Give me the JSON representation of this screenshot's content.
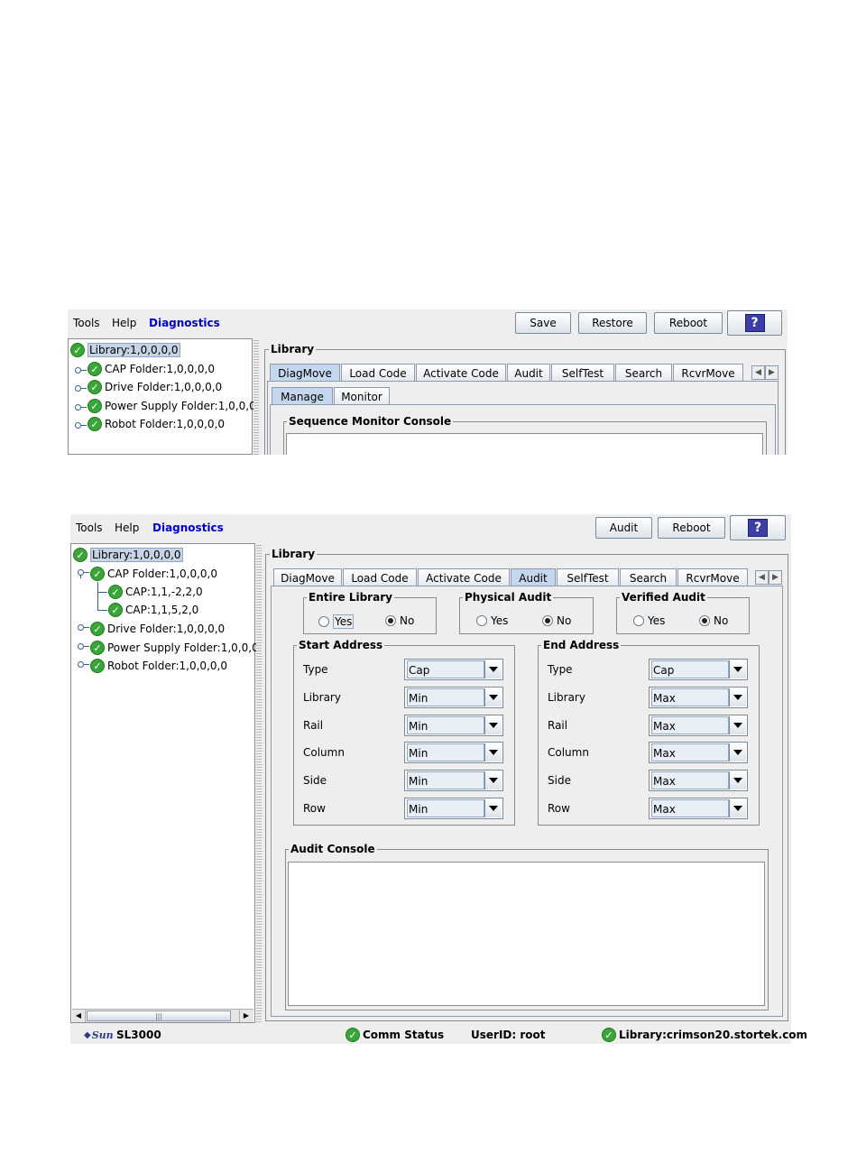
{
  "window1": {
    "menu": [
      "Tools",
      "Help",
      "Diagnostics"
    ],
    "toolbar": {
      "save": "Save",
      "restore": "Restore",
      "reboot": "Reboot",
      "help": "?"
    },
    "tree": {
      "root": "Library:1,0,0,0,0",
      "items": [
        "CAP Folder:1,0,0,0,0",
        "Drive Folder:1,0,0,0,0",
        "Power Supply Folder:1,0,0,0,",
        "Robot Folder:1,0,0,0,0"
      ]
    },
    "panel_title": "Library",
    "tabs": [
      "DiagMove",
      "Load Code",
      "Activate Code",
      "Audit",
      "SelfTest",
      "Search",
      "RcvrMove"
    ],
    "active_tab": "DiagMove",
    "subtabs": [
      "Manage",
      "Monitor"
    ],
    "console_title": "Sequence Monitor Console"
  },
  "window2": {
    "menu": [
      "Tools",
      "Help",
      "Diagnostics"
    ],
    "toolbar": {
      "audit": "Audit",
      "reboot": "Reboot",
      "help": "?"
    },
    "tree": {
      "root": "Library:1,0,0,0,0",
      "cap_folder": "CAP Folder:1,0,0,0,0",
      "cap_children": [
        "CAP:1,1,-2,2,0",
        "CAP:1,1,5,2,0"
      ],
      "items": [
        "Drive Folder:1,0,0,0,0",
        "Power Supply Folder:1,0,0,0,",
        "Robot Folder:1,0,0,0,0"
      ]
    },
    "panel_title": "Library",
    "tabs": [
      "DiagMove",
      "Load Code",
      "Activate Code",
      "Audit",
      "SelfTest",
      "Search",
      "RcvrMove"
    ],
    "active_tab": "Audit",
    "options": [
      {
        "title": "Entire Library",
        "yes": "Yes",
        "no": "No",
        "selected": "No"
      },
      {
        "title": "Physical Audit",
        "yes": "Yes",
        "no": "No",
        "selected": "No"
      },
      {
        "title": "Verified Audit",
        "yes": "Yes",
        "no": "No",
        "selected": "No"
      }
    ],
    "start_address": {
      "title": "Start Address",
      "fields": [
        {
          "label": "Type",
          "value": "Cap"
        },
        {
          "label": "Library",
          "value": "Min"
        },
        {
          "label": "Rail",
          "value": "Min"
        },
        {
          "label": "Column",
          "value": "Min"
        },
        {
          "label": "Side",
          "value": "Min"
        },
        {
          "label": "Row",
          "value": "Min"
        }
      ]
    },
    "end_address": {
      "title": "End Address",
      "fields": [
        {
          "label": "Type",
          "value": "Cap"
        },
        {
          "label": "Library",
          "value": "Max"
        },
        {
          "label": "Rail",
          "value": "Max"
        },
        {
          "label": "Column",
          "value": "Max"
        },
        {
          "label": "Side",
          "value": "Max"
        },
        {
          "label": "Row",
          "value": "Max"
        }
      ]
    },
    "console_title": "Audit Console",
    "status": {
      "logo_text": "Sun",
      "product": "SL3000",
      "comm": "Comm Status",
      "user": "UserID: root",
      "library": "Library:crimson20.stortek.com"
    }
  }
}
